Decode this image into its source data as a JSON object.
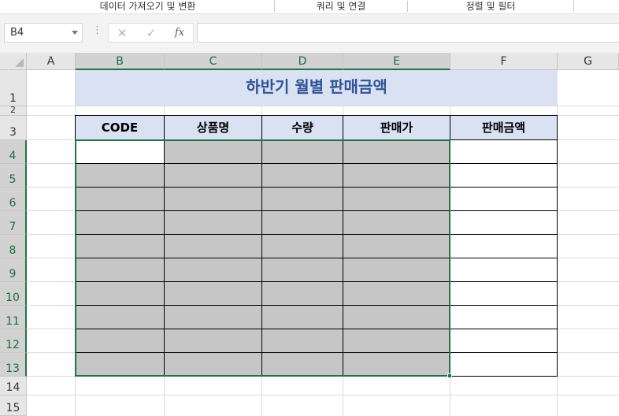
{
  "ribbon": {
    "groups": [
      {
        "label": "데이터 가져오기 및 변환"
      },
      {
        "label": "쿼리 및 연결"
      },
      {
        "label": "정렬 및 필터"
      }
    ]
  },
  "formula_bar": {
    "name_box": "B4",
    "cancel_icon": "✕",
    "enter_icon": "✓",
    "fx_label": "fx",
    "formula": ""
  },
  "columns": [
    "A",
    "B",
    "C",
    "D",
    "E",
    "F",
    "G"
  ],
  "rows": [
    "1",
    "2",
    "3",
    "4",
    "5",
    "6",
    "7",
    "8",
    "9",
    "10",
    "11",
    "12",
    "13",
    "14",
    "15"
  ],
  "active_cell": "B4",
  "selection": "B4:E13",
  "sheet": {
    "title": "하반기 월별 판매금액",
    "headers": [
      "CODE",
      "상품명",
      "수량",
      "판매가",
      "판매금액"
    ],
    "colors": {
      "header_fill": "#d9e1f2",
      "title_text": "#305496",
      "selection_border": "#217346",
      "input_fill": "#c6c6c6"
    }
  }
}
